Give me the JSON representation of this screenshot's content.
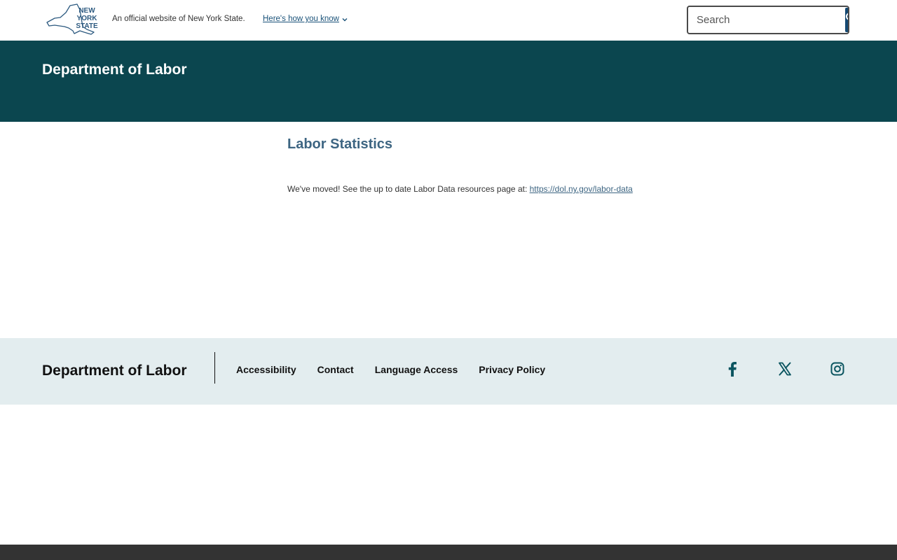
{
  "header": {
    "logo_text": [
      "NEW",
      "YORK",
      "STATE"
    ],
    "official_text": "An official website of New York State.",
    "how_know_label": "Here's how you know",
    "search": {
      "placeholder": "Search"
    }
  },
  "banner": {
    "agency_title": "Department of Labor"
  },
  "main": {
    "title": "Labor Statistics",
    "moved_text": "We've moved! See the up to date Labor Data resources page at: ",
    "moved_link": "https://dol.ny.gov/labor-data"
  },
  "footer": {
    "agency_title": "Department of Labor",
    "links": [
      "Accessibility",
      "Contact",
      "Language Access",
      "Privacy Policy"
    ],
    "social": [
      "facebook-icon",
      "x-icon",
      "instagram-icon"
    ]
  },
  "colors": {
    "banner_bg": "#0b464f",
    "footer_bg": "#e3edef",
    "link": "#3d6582",
    "search_button": "#154973",
    "social_icon": "#0b5560",
    "bottom_bar": "#333333"
  }
}
